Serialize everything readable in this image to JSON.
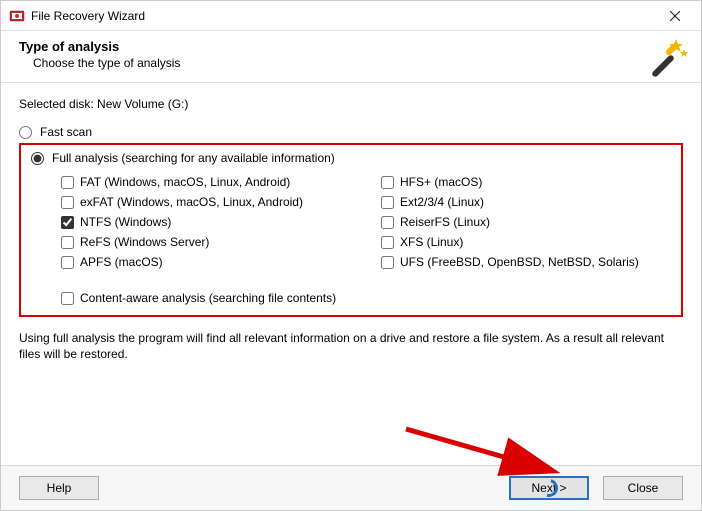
{
  "window": {
    "title": "File Recovery Wizard"
  },
  "header": {
    "title": "Type of analysis",
    "subtitle": "Choose the type of analysis"
  },
  "selected_disk_label": "Selected disk: New Volume (G:)",
  "radios": {
    "fast": "Fast scan",
    "full": "Full analysis (searching for any available information)"
  },
  "filesystems": {
    "left": [
      {
        "label": "FAT (Windows, macOS, Linux, Android)",
        "checked": false
      },
      {
        "label": "exFAT (Windows, macOS, Linux, Android)",
        "checked": false
      },
      {
        "label": "NTFS (Windows)",
        "checked": true
      },
      {
        "label": "ReFS (Windows Server)",
        "checked": false
      },
      {
        "label": "APFS (macOS)",
        "checked": false
      }
    ],
    "right": [
      {
        "label": "HFS+ (macOS)",
        "checked": false
      },
      {
        "label": "Ext2/3/4 (Linux)",
        "checked": false
      },
      {
        "label": "ReiserFS (Linux)",
        "checked": false
      },
      {
        "label": "XFS (Linux)",
        "checked": false
      },
      {
        "label": "UFS (FreeBSD, OpenBSD, NetBSD, Solaris)",
        "checked": false
      }
    ]
  },
  "content_aware_label": "Content-aware analysis (searching file contents)",
  "description": "Using full analysis the program will find all relevant information on a drive and restore a file system. As a result all relevant files will be restored.",
  "buttons": {
    "help": "Help",
    "next": "Next >",
    "close": "Close"
  }
}
